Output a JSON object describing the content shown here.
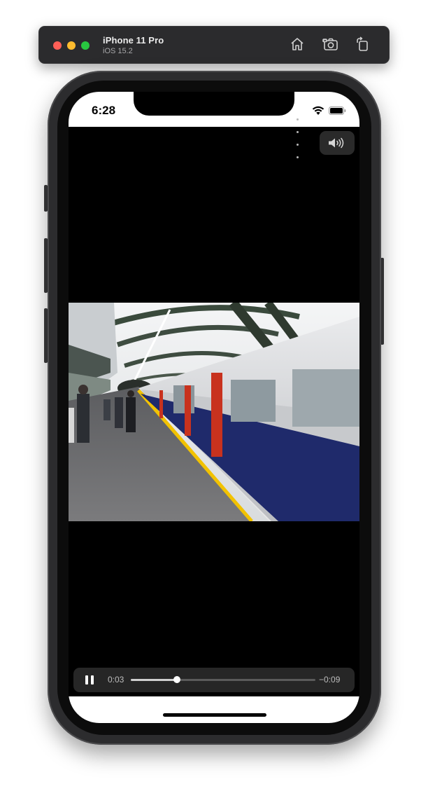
{
  "simulator": {
    "device_name": "iPhone 11 Pro",
    "os_version": "iOS 15.2",
    "toolbar_icons": [
      "home-icon",
      "screenshot-icon",
      "rotate-icon"
    ]
  },
  "status_bar": {
    "time": "6:28",
    "icons": [
      "signal-icon",
      "wifi-icon",
      "battery-icon"
    ]
  },
  "player": {
    "volume_icon": "speaker-volume-icon",
    "video_description": "London Underground train arriving at platform",
    "controls": {
      "play_state_icon": "pause-icon",
      "elapsed": "0:03",
      "remaining": "−0:09",
      "progress": 0.25
    }
  },
  "colors": {
    "control_bar": "#262626",
    "screen_background": "#000000",
    "platform_line": "#f2c200",
    "train_red": "#c8321e",
    "train_blue": "#1f2a6b"
  }
}
